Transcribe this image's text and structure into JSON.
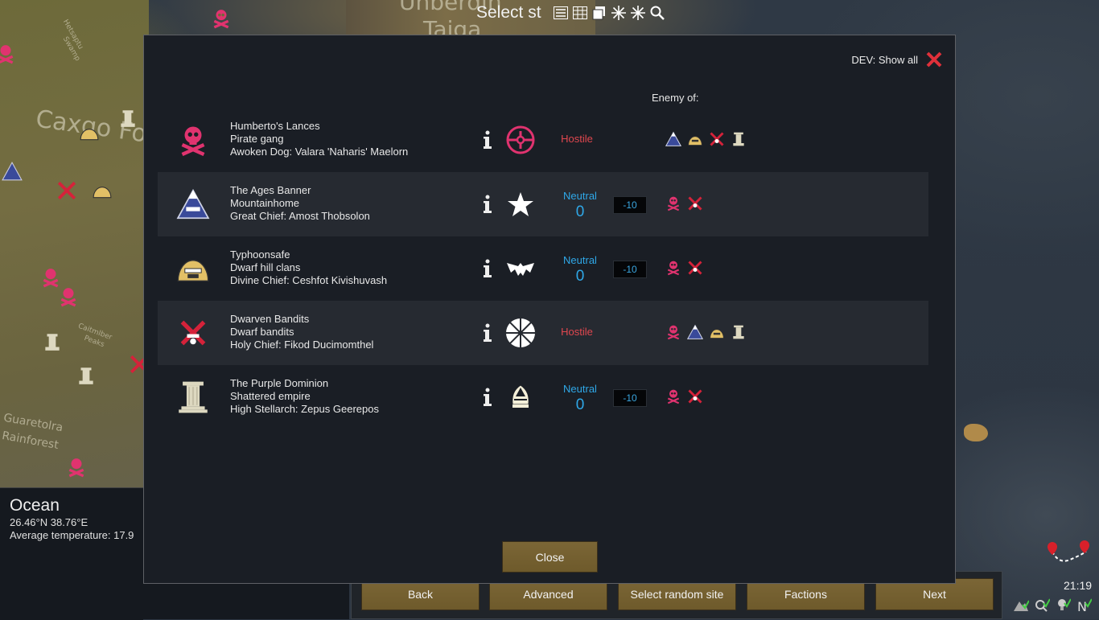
{
  "map": {
    "labels": [
      "Unberdin",
      "Taiga",
      "Caxgo Fo",
      "Guaretolra",
      "Rainforest",
      "Hetsaptu",
      "Swamp",
      "Caitmlber",
      "Peaks"
    ]
  },
  "topbar": {
    "title": "Select st",
    "icons": [
      "list-icon",
      "grid-icon",
      "layers-icon",
      "snowflake-icon",
      "snowflake-icon",
      "search-icon"
    ]
  },
  "tile_info": {
    "biome": "Ocean",
    "coords": "26.46°N 38.76°E",
    "temperature": "Average temperature: 17.9"
  },
  "dialog": {
    "dev_label": "DEV: Show all",
    "enemy_header": "Enemy of:",
    "close_label": "Close",
    "factions": [
      {
        "name": "Humberto's Lances",
        "type": "Pirate gang",
        "leader": "Awoken Dog: Valara 'Naharis' Maelorn",
        "icon": "skull-icon",
        "ideo_icon": "circle-cross-icon",
        "relation": "Hostile",
        "goodwill": "",
        "goodwill_change": "",
        "enemies": [
          "mountain-icon",
          "dome-icon",
          "crossed-swords-icon",
          "pillar-icon"
        ]
      },
      {
        "name": "The Ages Banner",
        "type": "Mountainhome",
        "leader": "Great Chief: Amost Thobsolon",
        "icon": "mountain-icon",
        "ideo_icon": "star-icon",
        "relation": "Neutral",
        "goodwill": "0",
        "goodwill_change": "-10",
        "enemies": [
          "skull-icon",
          "crossed-swords-icon"
        ]
      },
      {
        "name": "Typhoonsafe",
        "type": "Dwarf hill clans",
        "leader": "Divine Chief: Ceshfot Kivishuvash",
        "icon": "dome-icon",
        "ideo_icon": "bat-icon",
        "relation": "Neutral",
        "goodwill": "0",
        "goodwill_change": "-10",
        "enemies": [
          "skull-icon",
          "crossed-swords-icon"
        ]
      },
      {
        "name": "Dwarven Bandits",
        "type": "Dwarf bandits",
        "leader": "Holy Chief: Fikod Ducimomthel",
        "icon": "crossed-swords-icon",
        "ideo_icon": "asterisk-icon",
        "relation": "Hostile",
        "goodwill": "",
        "goodwill_change": "",
        "enemies": [
          "skull-icon",
          "mountain-icon",
          "dome-icon",
          "pillar-icon"
        ]
      },
      {
        "name": "The Purple Dominion",
        "type": "Shattered empire",
        "leader": "High Stellarch: Zepus Geerepos",
        "icon": "pillar-icon",
        "ideo_icon": "helmet-icon",
        "relation": "Neutral",
        "goodwill": "0",
        "goodwill_change": "-10",
        "enemies": [
          "skull-icon",
          "crossed-swords-icon"
        ]
      }
    ]
  },
  "bottom_buttons": [
    "Back",
    "Advanced",
    "Select random site",
    "Factions",
    "Next"
  ],
  "clock": "21:19",
  "colors": {
    "hostile": "#e0474f",
    "neutral": "#2fa8e8",
    "skull": "#e0336f",
    "button": "#6e5a2b"
  }
}
